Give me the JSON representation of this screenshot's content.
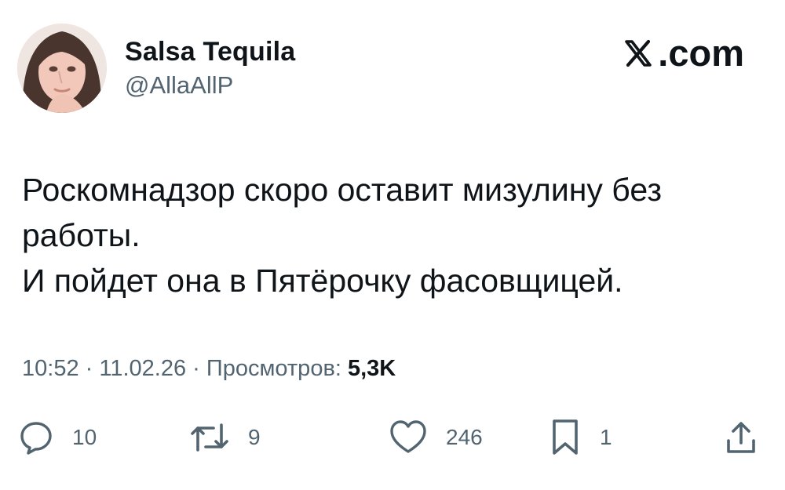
{
  "author": {
    "display_name": "Salsa Tequila",
    "handle": "@AllaAllP",
    "avatar_icon": "profile-avatar"
  },
  "brand": {
    "logo_icon": "x-logo-icon",
    "label": ".com"
  },
  "tweet": {
    "lines": [
      "Роскомнадзор скоро оставит мизулину без",
      "работы.",
      "И пойдет она в Пятёрочку фасовщицей."
    ]
  },
  "meta": {
    "time": "10:52",
    "separator": " · ",
    "date": "11.02.26",
    "views_label": "Просмотров:",
    "views_count": "5,3K"
  },
  "actions": {
    "reply": {
      "icon": "reply-icon",
      "count": "10"
    },
    "repost": {
      "icon": "repost-icon",
      "count": "9"
    },
    "like": {
      "icon": "heart-icon",
      "count": "246"
    },
    "bookmark": {
      "icon": "bookmark-icon",
      "count": "1"
    },
    "share": {
      "icon": "share-icon"
    }
  },
  "colors": {
    "text_primary": "#0f1419",
    "text_secondary": "#536471",
    "background": "#ffffff"
  }
}
